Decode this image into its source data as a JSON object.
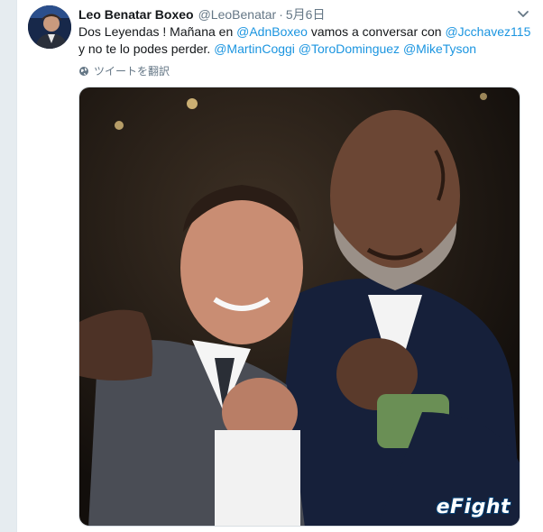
{
  "tweet": {
    "author_name": "Leo Benatar Boxeo",
    "author_handle": "@LeoBenatar",
    "separator": "·",
    "date": "5月6日",
    "text_parts": {
      "p1": "Dos Leyendas ! Mañana en ",
      "m1": "@AdnBoxeo",
      "p2": " vamos a conversar con ",
      "m2": "@Jcchavez115",
      "p3": "y no te lo podes perder. ",
      "m3": "@MartinCoggi",
      "m4": "@ToroDominguez",
      "m5": "@MikeTyson"
    },
    "translate_label": "ツイートを翻訳"
  },
  "watermark": "eFight",
  "colors": {
    "link": "#1b95e0",
    "muted": "#657786",
    "text": "#14171a"
  },
  "icons": {
    "caret": "chevron-down-icon",
    "translate": "globe-icon"
  }
}
